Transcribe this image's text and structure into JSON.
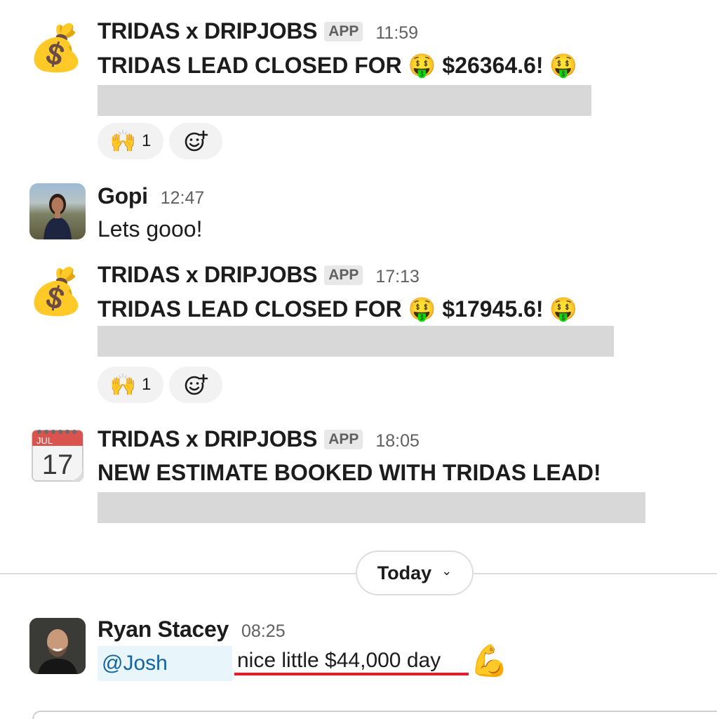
{
  "messages": [
    {
      "sender": "TRIDAS x DRIPJOBS",
      "badge": "APP",
      "time": "11:59",
      "avatar_emoji": "💰",
      "text_prefix": "TRIDAS LEAD CLOSED FOR",
      "emoji": "🤑",
      "amount": "$26364.6!",
      "reaction_emoji": "🙌",
      "reaction_count": "1"
    },
    {
      "sender": "Gopi",
      "time": "12:47",
      "text": "Lets gooo!"
    },
    {
      "sender": "TRIDAS x DRIPJOBS",
      "badge": "APP",
      "time": "17:13",
      "avatar_emoji": "💰",
      "text_prefix": "TRIDAS LEAD CLOSED FOR",
      "emoji": "🤑",
      "amount": "$17945.6!",
      "reaction_emoji": "🙌",
      "reaction_count": "1"
    },
    {
      "sender": "TRIDAS x DRIPJOBS",
      "badge": "APP",
      "time": "18:05",
      "calendar_month": "JUL",
      "calendar_day": "17",
      "text": "NEW ESTIMATE BOOKED WITH TRIDAS LEAD!"
    }
  ],
  "divider": {
    "label": "Today",
    "chevron": "⌄"
  },
  "latest": {
    "sender": "Ryan Stacey",
    "time": "08:25",
    "mention": "@Josh",
    "text": "nice little $44,000 day",
    "emoji": "💪"
  },
  "icons": {
    "add_reaction": "add-reaction-icon"
  },
  "colors": {
    "mention_bg": "#e8f5fa",
    "mention_text": "#1264a3",
    "underline": "#e01e2a"
  }
}
